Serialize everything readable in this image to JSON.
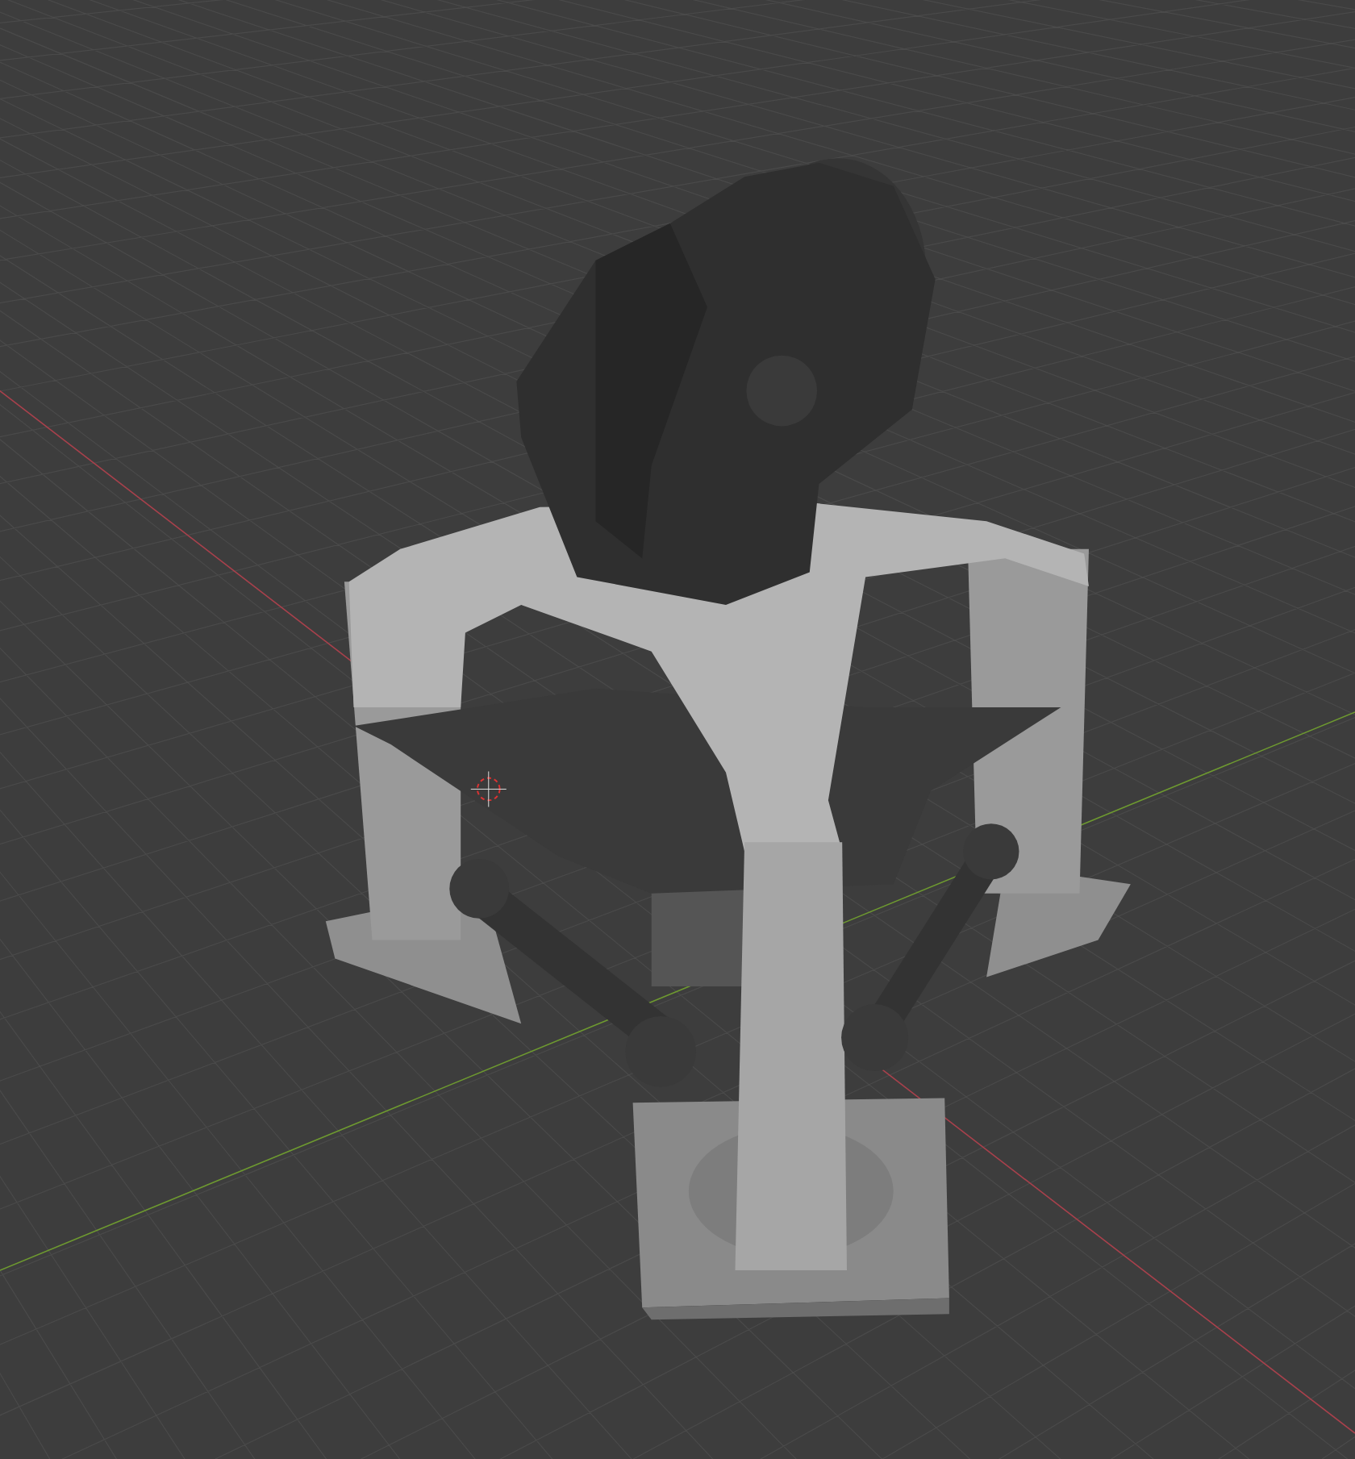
{
  "viewport": {
    "grid": true,
    "cursor": true,
    "axes": [
      {
        "kind": "x",
        "color": "#a8414c"
      },
      {
        "kind": "y",
        "color": "#6e9a30"
      }
    ]
  }
}
